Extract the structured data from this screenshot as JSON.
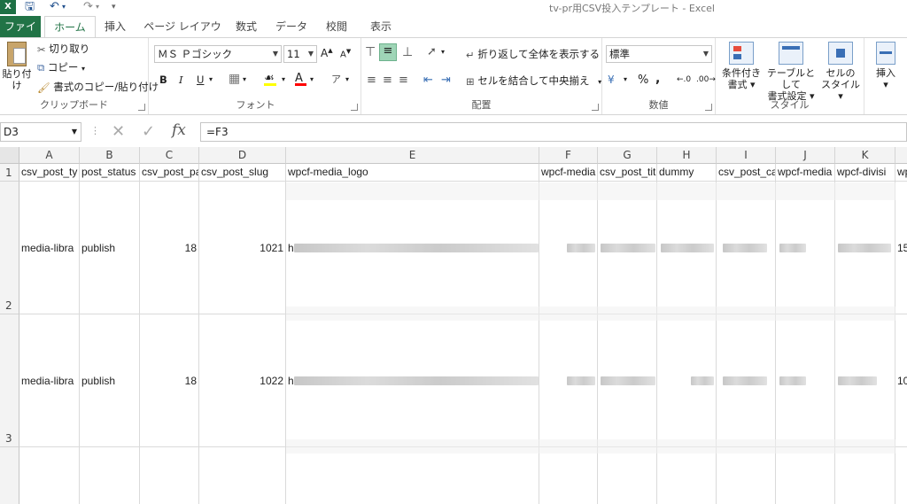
{
  "window": {
    "title": "tv-pr用CSV投入テンプレート - Excel",
    "app_badge": "X",
    "quick_access": [
      "save-icon",
      "undo-icon",
      "redo-icon",
      "customize-icon"
    ]
  },
  "tabs": [
    "ファイル",
    "ホーム",
    "挿入",
    "ページ レイアウト",
    "数式",
    "データ",
    "校閲",
    "表示"
  ],
  "ribbon": {
    "clipboard": {
      "paste": "貼り付け",
      "cut": "切り取り",
      "copy": "コピー",
      "format_painter": "書式のコピー/貼り付け",
      "label": "クリップボード"
    },
    "font": {
      "name": "ＭＳ Ｐゴシック",
      "size": "11",
      "bold": "B",
      "italic": "I",
      "underline": "U",
      "label": "フォント"
    },
    "alignment": {
      "wrap": "折り返して全体を表示する",
      "merge": "セルを結合して中央揃え",
      "label": "配置"
    },
    "number": {
      "format": "標準",
      "percent": "%",
      "comma": ",",
      "label": "数値"
    },
    "styles": {
      "conditional": [
        "条件付き",
        "書式"
      ],
      "table": [
        "テーブルとして",
        "書式設定"
      ],
      "cell": [
        "セルの",
        "スタイル"
      ],
      "label": "スタイル"
    },
    "cells": {
      "insert": "挿入"
    }
  },
  "formula_bar": {
    "name_box": "D3",
    "formula": "=F3"
  },
  "sheet": {
    "columns": [
      "A",
      "B",
      "C",
      "D",
      "E",
      "F",
      "G",
      "H",
      "I",
      "J",
      "K"
    ],
    "rows": [
      "1",
      "2",
      "3"
    ],
    "header_row": [
      "csv_post_ty",
      "post_status",
      "csv_post_pa",
      "csv_post_slug",
      "wpcf-media_logo",
      "wpcf-media",
      "csv_post_tit",
      "dummy",
      "csv_post_ca",
      "wpcf-media",
      "wpcf-divisi",
      "wp"
    ],
    "data_rows": [
      {
        "a": "media-libra",
        "b": "publish",
        "c": "18",
        "d": "1021",
        "e": "h",
        "l": "15"
      },
      {
        "a": "media-libra",
        "b": "publish",
        "c": "18",
        "d": "1022",
        "e": "h",
        "l": "10"
      }
    ]
  }
}
